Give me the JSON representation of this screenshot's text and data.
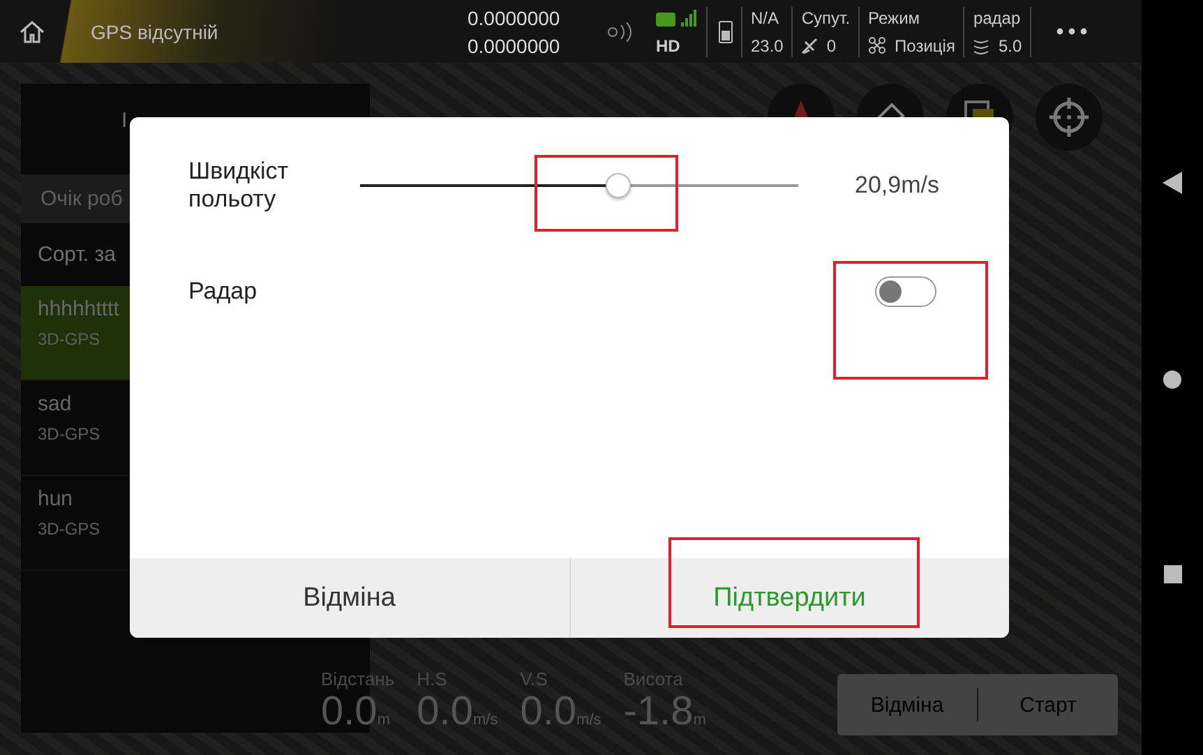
{
  "top_bar": {
    "gps_status": "GPS відсутній",
    "latitude": "0.0000000",
    "longitude": "0.0000000",
    "hd_label": "HD",
    "battery": {
      "label": "N/A",
      "value": "23.0"
    },
    "satellites": {
      "label": "Супут.",
      "value": "0"
    },
    "mode": {
      "label": "Режим",
      "value": "Позиція"
    },
    "radar": {
      "label": "радар",
      "value": "5.0"
    }
  },
  "mission_panel": {
    "title": "I",
    "filter": "Очік роб",
    "sort": "Сорт. за",
    "items": [
      {
        "name": "hhhhhtttt",
        "status": "3D-GPS",
        "selected": true
      },
      {
        "name": "sad",
        "status": "3D-GPS",
        "selected": false
      },
      {
        "name": "hun",
        "status": "3D-GPS",
        "selected": false
      }
    ]
  },
  "telemetry": [
    {
      "label": "Відстань",
      "value": "0.0",
      "unit": "m"
    },
    {
      "label": "H.S",
      "value": "0.0",
      "unit": "m/s"
    },
    {
      "label": "V.S",
      "value": "0.0",
      "unit": "m/s"
    },
    {
      "label": "Висота",
      "value": "-1.8",
      "unit": "m"
    }
  ],
  "action_buttons": [
    "Відміна",
    "Старт"
  ],
  "dialog": {
    "rows": [
      {
        "kind": "slider",
        "label": "Швидкіст польоту",
        "level": 0.59,
        "reading": "20,9m/s"
      },
      {
        "kind": "switch",
        "label": "Радар",
        "on": false
      }
    ],
    "cancel": "Відміна",
    "confirm": "Підтвердити"
  }
}
